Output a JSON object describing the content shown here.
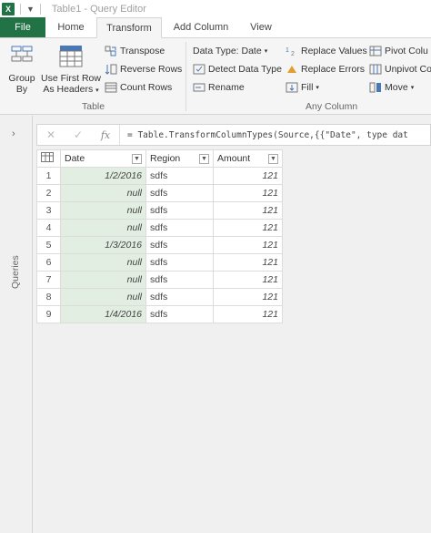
{
  "window": {
    "app_icon": "X",
    "title": "Table1 - Query Editor"
  },
  "tabs": [
    {
      "label": "File"
    },
    {
      "label": "Home"
    },
    {
      "label": "Transform"
    },
    {
      "label": "Add Column"
    },
    {
      "label": "View"
    }
  ],
  "ribbon": {
    "group_by": "Group\nBy",
    "group_by_l1": "Group",
    "group_by_l2": "By",
    "first_row_l1": "Use First Row",
    "first_row_l2": "As Headers",
    "transpose": "Transpose",
    "reverse_rows": "Reverse Rows",
    "count_rows": "Count Rows",
    "table_group": "Table",
    "data_type": "Data Type: Date",
    "detect_data_type": "Detect Data Type",
    "rename": "Rename",
    "replace_values": "Replace Values",
    "replace_errors": "Replace Errors",
    "fill": "Fill",
    "pivot_column": "Pivot Colu",
    "unpivot_columns": "Unpivot Co",
    "move": "Move",
    "any_column_group": "Any Column"
  },
  "queries_pane": {
    "label": "Queries"
  },
  "formula_bar": {
    "fx": "fx",
    "formula": "= Table.TransformColumnTypes(Source,{{\"Date\", type dat"
  },
  "grid": {
    "columns": [
      "Date",
      "Region",
      "Amount"
    ],
    "rows": [
      {
        "n": "1",
        "date": "1/2/2016",
        "region": "sdfs",
        "amount": "121"
      },
      {
        "n": "2",
        "date": "null",
        "region": "sdfs",
        "amount": "121"
      },
      {
        "n": "3",
        "date": "null",
        "region": "sdfs",
        "amount": "121"
      },
      {
        "n": "4",
        "date": "null",
        "region": "sdfs",
        "amount": "121"
      },
      {
        "n": "5",
        "date": "1/3/2016",
        "region": "sdfs",
        "amount": "121"
      },
      {
        "n": "6",
        "date": "null",
        "region": "sdfs",
        "amount": "121"
      },
      {
        "n": "7",
        "date": "null",
        "region": "sdfs",
        "amount": "121"
      },
      {
        "n": "8",
        "date": "null",
        "region": "sdfs",
        "amount": "121"
      },
      {
        "n": "9",
        "date": "1/4/2016",
        "region": "sdfs",
        "amount": "121"
      }
    ]
  },
  "colors": {
    "accent": "#217346",
    "date_column": "#e2eee1"
  }
}
